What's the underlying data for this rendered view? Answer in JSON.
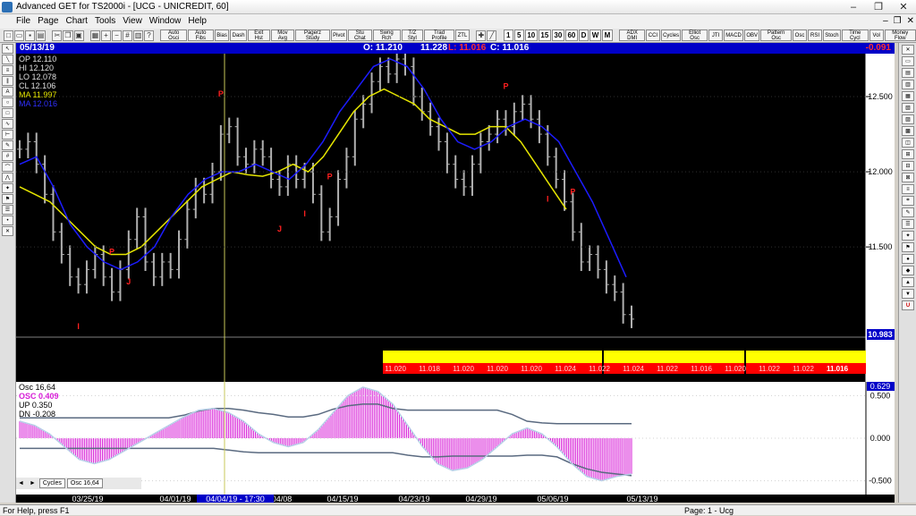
{
  "window": {
    "title": "Advanced GET for TS2000i - [UCG - UNICREDIT, 60]",
    "min": "–",
    "max": "❐",
    "close": "✕"
  },
  "menu": [
    "File",
    "Page",
    "Chart",
    "Tools",
    "View",
    "Window",
    "Help"
  ],
  "toolbar": {
    "studies": [
      "Auto Osci",
      "Auto Fibs",
      "Bias",
      "Dash",
      "Exit Hst",
      "Mov Avg",
      "Pagerz Study",
      "Pivot",
      "Stu Chat",
      "Swng Rch",
      "T/Z Styl",
      "Trad Profile",
      "ZTL"
    ],
    "timeframes": [
      "1",
      "5",
      "10",
      "15",
      "30",
      "60",
      "D",
      "W",
      "M"
    ],
    "studies2": [
      "ADX DMI",
      "CCI",
      "Cycles",
      "Elliot Osc",
      "JTI",
      "MACD",
      "OBV",
      "Pattern Osc",
      "Osc",
      "RSI",
      "Stoch",
      "Time Cycl",
      "Vol",
      "Money Flow"
    ]
  },
  "infobar": {
    "date": "05/13/19",
    "open": "O: 11.210",
    "high": "11.228",
    "low": "L: 11.016",
    "close": "C: 11.016",
    "change": "-0.091"
  },
  "legend": {
    "op": "OP  12.110",
    "hi": "HI   12.120",
    "lo": "LO  12.078",
    "cl": "CL  12.106",
    "ma_yellow": "MA  11.997",
    "ma_blue": "MA  12.016"
  },
  "osc_legend": {
    "title": "Osc 16,64",
    "osc": "OSC  0.409",
    "up": "UP    0.350",
    "dn": "DN   -0.208"
  },
  "cursor": {
    "label": "04/04/19 - 17:30"
  },
  "price_tag": "10.983",
  "yellow_band": {
    "values": [
      "11.020",
      "11.018",
      "11.020",
      "11.020",
      "11.020",
      "11.024",
      "11.022",
      "11.024",
      "11.022",
      "11.016",
      "11.020",
      "11.022",
      "11.022",
      "11.016"
    ]
  },
  "chart_data": [
    {
      "type": "bar",
      "subtype": "ohlc",
      "ylim": [
        10.9,
        12.75
      ],
      "yticks": [
        "12.500",
        "12.000",
        "11.500",
        "10.983"
      ],
      "xticks": [
        "03/25/19",
        "04/01/19",
        "04/08/19",
        "04/15/19",
        "04/23/19",
        "04/29/19",
        "05/06/19",
        "05/13/19"
      ],
      "close_series": [
        12.15,
        12.2,
        12.05,
        11.85,
        11.6,
        11.45,
        11.3,
        11.25,
        11.35,
        11.45,
        11.3,
        11.2,
        11.35,
        11.55,
        11.7,
        11.4,
        11.3,
        11.4,
        11.35,
        11.55,
        11.75,
        11.9,
        11.85,
        12.0,
        12.25,
        12.3,
        12.1,
        12.05,
        12.15,
        12.1,
        11.95,
        11.9,
        12.05,
        11.95,
        12.0,
        11.85,
        11.6,
        11.7,
        11.95,
        12.1,
        12.35,
        12.45,
        12.6,
        12.7,
        12.65,
        12.75,
        12.7,
        12.5,
        12.4,
        12.3,
        12.2,
        12.05,
        11.95,
        11.9,
        12.05,
        12.2,
        12.25,
        12.35,
        12.3,
        12.4,
        12.45,
        12.35,
        12.25,
        12.1,
        11.95,
        11.8,
        11.6,
        11.4,
        11.45,
        11.35,
        11.25,
        11.2,
        11.05,
        11.02
      ],
      "markers": [
        {
          "label": "I",
          "i": 7
        },
        {
          "label": "P",
          "i": 11
        },
        {
          "label": "J",
          "i": 13
        },
        {
          "label": "P",
          "i": 24
        },
        {
          "label": "J",
          "i": 31
        },
        {
          "label": "I",
          "i": 34
        },
        {
          "label": "P",
          "i": 37
        },
        {
          "label": "P",
          "i": 58
        },
        {
          "label": "P",
          "i": 66
        },
        {
          "label": "I",
          "i": 63
        }
      ],
      "ma_yellow": [
        11.9,
        11.85,
        11.8,
        11.7,
        11.6,
        11.5,
        11.45,
        11.45,
        11.5,
        11.6,
        11.7,
        11.8,
        11.9,
        11.95,
        12.0,
        11.98,
        11.97,
        12.0,
        12.05,
        12.0,
        12.1,
        12.25,
        12.4,
        12.5,
        12.55,
        12.5,
        12.45,
        12.35,
        12.3,
        12.25,
        12.25,
        12.3,
        12.3,
        12.2,
        12.05,
        11.9,
        11.75
      ],
      "ma_blue": [
        12.05,
        12.1,
        11.9,
        11.65,
        11.5,
        11.4,
        11.35,
        11.4,
        11.5,
        11.7,
        11.85,
        11.95,
        12.0,
        12.0,
        12.05,
        12.0,
        11.95,
        12.05,
        12.2,
        12.4,
        12.55,
        12.7,
        12.75,
        12.7,
        12.55,
        12.35,
        12.2,
        12.15,
        12.2,
        12.3,
        12.35,
        12.3,
        12.2,
        12.0,
        11.8,
        11.55,
        11.3
      ]
    },
    {
      "type": "area",
      "title": "Osc 16,64",
      "ylim": [
        -0.62,
        0.62
      ],
      "yticks": [
        "0.629",
        "0.500",
        "0.000",
        "-0.500"
      ],
      "osc": [
        0.2,
        0.15,
        0.05,
        -0.1,
        -0.25,
        -0.3,
        -0.25,
        -0.15,
        -0.05,
        0.05,
        0.15,
        0.25,
        0.33,
        0.35,
        0.3,
        0.2,
        0.05,
        -0.05,
        -0.1,
        -0.05,
        0.1,
        0.3,
        0.5,
        0.6,
        0.55,
        0.4,
        0.15,
        -0.1,
        -0.3,
        -0.38,
        -0.35,
        -0.25,
        -0.1,
        0.05,
        0.12,
        0.05,
        -0.1,
        -0.3,
        -0.45,
        -0.5,
        -0.45,
        -0.42
      ],
      "up": [
        0.24,
        0.24,
        0.24,
        0.24,
        0.24,
        0.24,
        0.24,
        0.24,
        0.24,
        0.24,
        0.24,
        0.27,
        0.32,
        0.35,
        0.35,
        0.33,
        0.3,
        0.28,
        0.25,
        0.25,
        0.28,
        0.34,
        0.38,
        0.4,
        0.4,
        0.35,
        0.33,
        0.33,
        0.33,
        0.33,
        0.33,
        0.33,
        0.33,
        0.28,
        0.2,
        0.18,
        0.17,
        0.17,
        0.17,
        0.17,
        0.17,
        0.17
      ],
      "dn": [
        -0.12,
        -0.12,
        -0.12,
        -0.12,
        -0.12,
        -0.12,
        -0.12,
        -0.12,
        -0.12,
        -0.12,
        -0.12,
        -0.12,
        -0.12,
        -0.12,
        -0.14,
        -0.16,
        -0.17,
        -0.17,
        -0.17,
        -0.17,
        -0.17,
        -0.17,
        -0.17,
        -0.17,
        -0.17,
        -0.17,
        -0.2,
        -0.22,
        -0.22,
        -0.21,
        -0.21,
        -0.21,
        -0.21,
        -0.21,
        -0.2,
        -0.2,
        -0.22,
        -0.3,
        -0.36,
        -0.4,
        -0.42,
        -0.44
      ]
    }
  ],
  "tabs": {
    "cycles": "Cycles",
    "osc": "Osc 16,64",
    "nav": [
      "◄",
      "►"
    ]
  },
  "status": {
    "help": "For Help, press F1",
    "page": "Page: 1 - Ucg"
  },
  "colors": {
    "price": "#b0b0b0",
    "ma_yellow": "#e6e600",
    "ma_blue": "#1c1cff",
    "osc": "#d71cd7",
    "bands": "#b8d0e8",
    "band_yellow": "#ffff00",
    "band_red": "#ff0000"
  }
}
